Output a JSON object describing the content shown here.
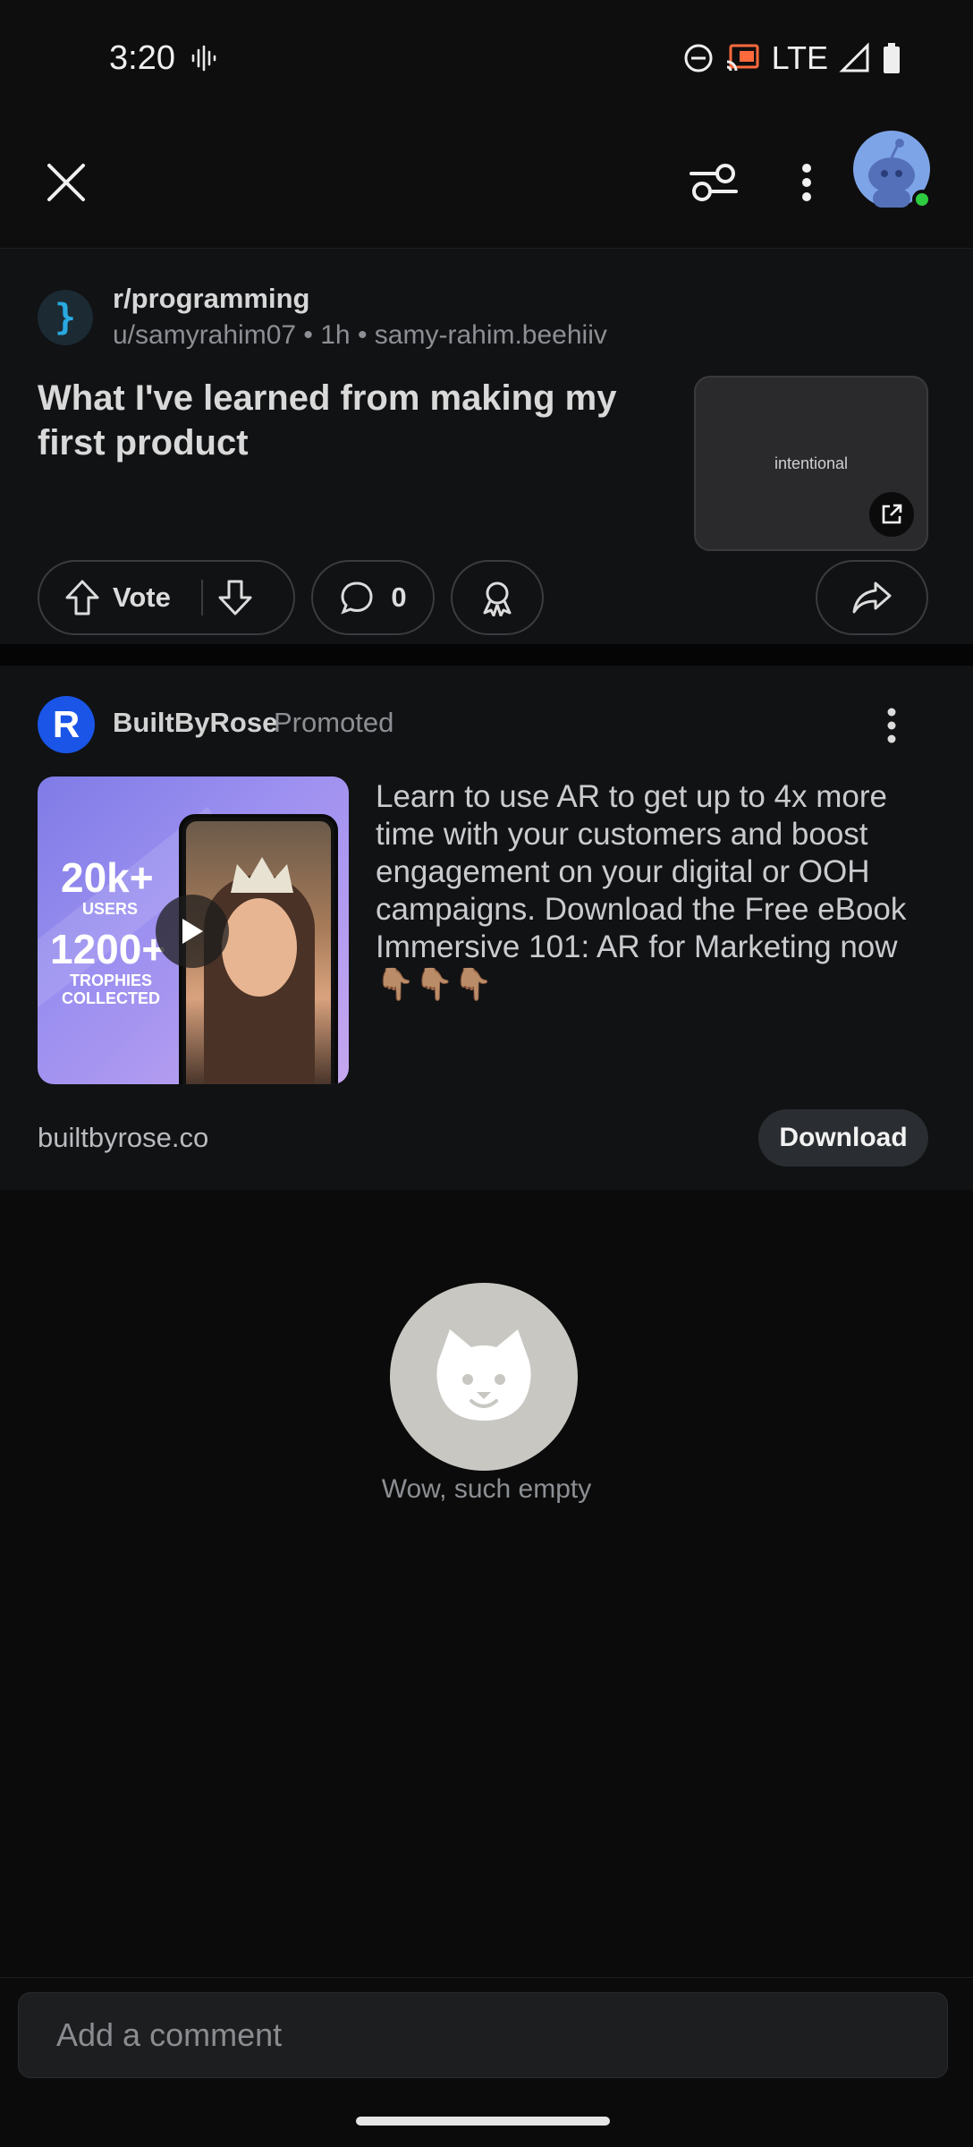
{
  "status_bar": {
    "time": "3:20",
    "network": "LTE",
    "icons": [
      "sound-wave-icon",
      "do-not-disturb-icon",
      "cast-icon",
      "signal-icon",
      "battery-icon"
    ]
  },
  "app_bar": {
    "icons": [
      "close-icon",
      "sliders-icon",
      "more-vertical-icon",
      "avatar"
    ]
  },
  "post": {
    "subreddit": "r/programming",
    "meta": "u/samyrahim07 • 1h • samy-rahim.beehiiv",
    "title": "What I've learned from making my first product",
    "thumbnail_text": "intentional",
    "vote_label": "Vote",
    "comment_count": "0"
  },
  "ad": {
    "logo_letter": "R",
    "advertiser": "BuiltByRose",
    "promoted_label": "Promoted",
    "media": {
      "stat1": "20k+",
      "stat1_label": "USERS",
      "stat2": "1200+",
      "stat2_label": "TROPHIES COLLECTED"
    },
    "body": "Learn to use AR to get up to 4x more time with your customers and boost engagement on your digital or OOH campaigns. Download the Free eBook Immersive 101: AR for Marketing now 👇🏽👇🏽👇🏽",
    "domain": "builtbyrose.co",
    "cta": "Download"
  },
  "empty_state": {
    "text": "Wow, such empty"
  },
  "comment_bar": {
    "placeholder": "Add a comment"
  },
  "colors": {
    "background": "#0b0b0b",
    "card": "#111214",
    "ad_logo": "#1a55e8",
    "online_dot": "#2ecc40",
    "empty_icon": "#c8c7c2"
  }
}
